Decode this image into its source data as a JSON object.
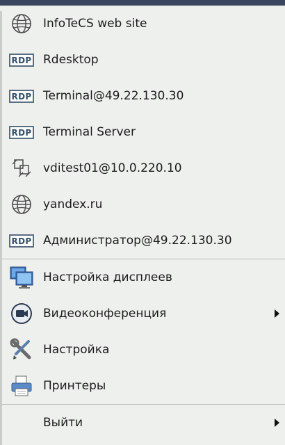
{
  "menu": {
    "items": [
      {
        "label": "InfoTeCS web site",
        "icon": "globe-icon"
      },
      {
        "label": "Rdesktop",
        "icon": "rdp-icon",
        "badge": "RDP"
      },
      {
        "label": "Terminal@49.22.130.30",
        "icon": "rdp-icon",
        "badge": "RDP"
      },
      {
        "label": "Terminal Server",
        "icon": "rdp-icon",
        "badge": "RDP"
      },
      {
        "label": "vditest01@10.0.220.10",
        "icon": "vdi-windows-icon"
      },
      {
        "label": "yandex.ru",
        "icon": "globe-icon"
      },
      {
        "label": "Администратор@49.22.130.30",
        "icon": "rdp-icon",
        "badge": "RDP"
      },
      {
        "label": "Настройка дисплеев",
        "icon": "monitors-icon"
      },
      {
        "label": "Видеоконференция",
        "icon": "video-camera-icon",
        "submenu": true
      },
      {
        "label": "Настройка",
        "icon": "tools-icon"
      },
      {
        "label": "Принтеры",
        "icon": "printer-icon"
      },
      {
        "label": "Выйти",
        "icon": "",
        "submenu": true
      }
    ]
  }
}
